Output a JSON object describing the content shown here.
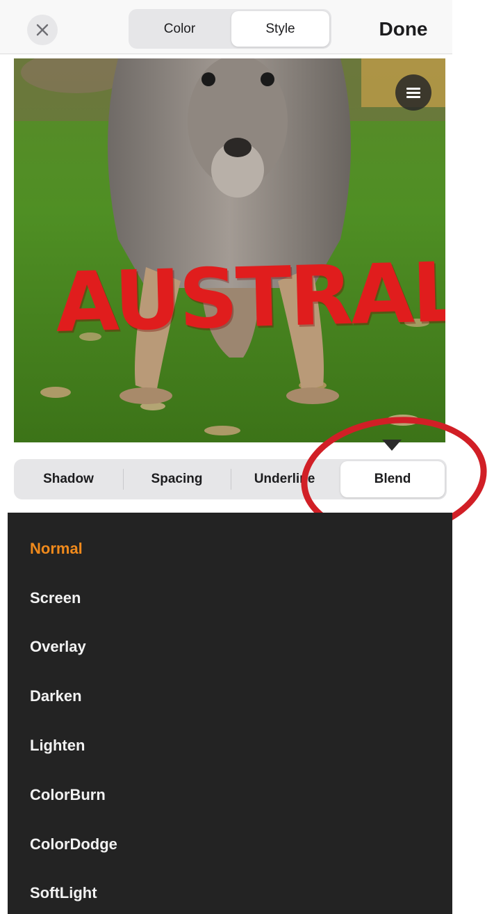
{
  "top_bar": {
    "close_icon": "x-icon",
    "tabs": [
      {
        "label": "Color",
        "selected": false
      },
      {
        "label": "Style",
        "selected": true
      }
    ],
    "done_label": "Done"
  },
  "canvas": {
    "overlay_text": "AUSTRAL",
    "overlay_color": "#e01d1d",
    "menu_icon": "hamburger-menu-icon"
  },
  "style_tabs": [
    {
      "label": "Shadow",
      "selected": false
    },
    {
      "label": "Spacing",
      "selected": false
    },
    {
      "label": "Underline",
      "selected": false
    },
    {
      "label": "Blend",
      "selected": true
    }
  ],
  "blend_modes": [
    {
      "label": "Normal",
      "selected": true
    },
    {
      "label": "Screen",
      "selected": false
    },
    {
      "label": "Overlay",
      "selected": false
    },
    {
      "label": "Darken",
      "selected": false
    },
    {
      "label": "Lighten",
      "selected": false
    },
    {
      "label": "ColorBurn",
      "selected": false
    },
    {
      "label": "ColorDodge",
      "selected": false
    },
    {
      "label": "SoftLight",
      "selected": false
    }
  ],
  "colors": {
    "accent_selected": "#f08a1c",
    "annotation": "#d11f26",
    "list_background": "#232323"
  }
}
